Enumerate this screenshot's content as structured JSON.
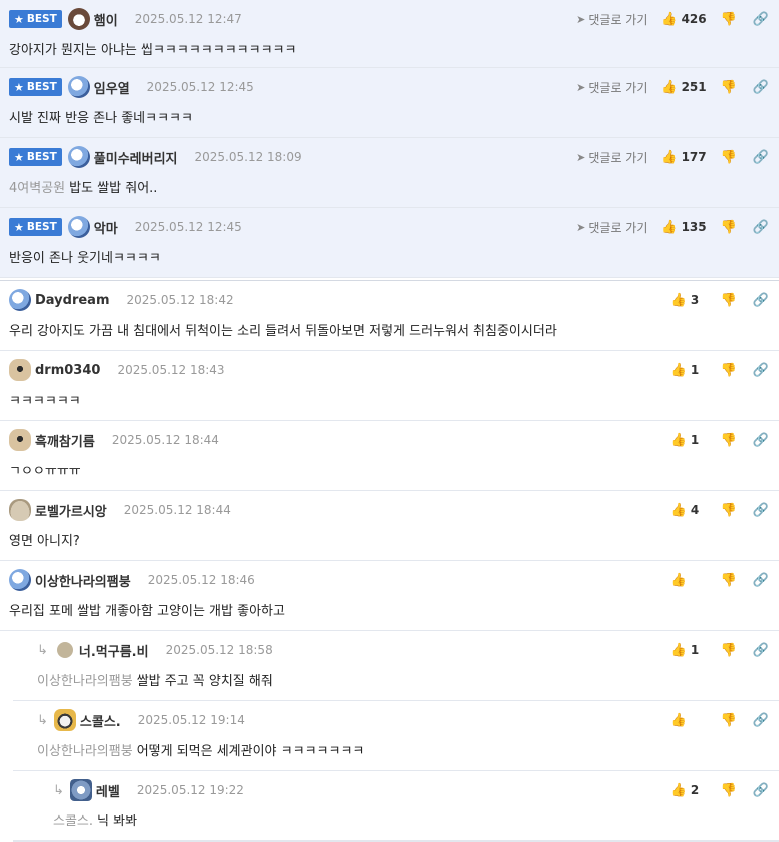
{
  "ui": {
    "best_label": "BEST",
    "goto_label": "댓글로 가기"
  },
  "best_comments": [
    {
      "avatar": "dog-face",
      "nick": "햄이",
      "date": "2025.05.12 12:47",
      "likes": "426",
      "mention": "",
      "text": "강아지가 뭔지는 아냐는 씹ㅋㅋㅋㅋㅋㅋㅋㅋㅋㅋㅋㅋ"
    },
    {
      "avatar": "ghost",
      "nick": "임우열",
      "date": "2025.05.12 12:45",
      "likes": "251",
      "mention": "",
      "text": "시발 진짜 반응 존나 좋네ㅋㅋㅋㅋ"
    },
    {
      "avatar": "ghost",
      "nick": "풀미수레버리지",
      "date": "2025.05.12 18:09",
      "likes": "177",
      "mention": "4여벽공원",
      "text": "밥도 쌀밥 줘어.."
    },
    {
      "avatar": "ghost",
      "nick": "악마",
      "date": "2025.05.12 12:45",
      "likes": "135",
      "mention": "",
      "text": "반응이 존나 웃기네ㅋㅋㅋㅋ"
    }
  ],
  "comments": [
    {
      "avatar": "ghost",
      "nick": "Daydream",
      "date": "2025.05.12 18:42",
      "likes": "3",
      "mention": "",
      "text": "우리 강아지도 가끔 내 침대에서 뒤척이는 소리 들려서 뒤돌아보면 저렇게 드러누워서 취침중이시더라"
    },
    {
      "avatar": "puppy",
      "nick": "drm0340",
      "date": "2025.05.12 18:43",
      "likes": "1",
      "mention": "",
      "text": "ㅋㅋㅋㅋㅋㅋ"
    },
    {
      "avatar": "puppy",
      "nick": "흑깨참기름",
      "date": "2025.05.12 18:44",
      "likes": "1",
      "mention": "",
      "text": "ㄱㅇㅇㅠㅠㅠ"
    },
    {
      "avatar": "seal",
      "nick": "로벨가르시앙",
      "date": "2025.05.12 18:44",
      "likes": "4",
      "mention": "",
      "text": "영면 아니지?"
    },
    {
      "avatar": "ghost",
      "nick": "이상한나라의팸붕",
      "date": "2025.05.12 18:46",
      "likes": "",
      "mention": "",
      "text": "우리집 포메 쌀밥 개좋아함 고양이는 개밥 좋아하고"
    }
  ],
  "replies": [
    {
      "avatar": "dot",
      "nick": "너.먹구름.비",
      "date": "2025.05.12 18:58",
      "likes": "1",
      "mention": "이상한나라의팸붕",
      "text": "쌀밥 주고 꼭 양치질 해줘"
    },
    {
      "avatar": "fox",
      "nick": "스콜스.",
      "date": "2025.05.12 19:14",
      "likes": "",
      "mention": "이상한나라의팸붕",
      "text": "어떻게 되먹은 세계관이야 ㅋㅋㅋㅋㅋㅋㅋ"
    }
  ],
  "nested_replies": [
    {
      "avatar": "wolf",
      "nick": "레벨",
      "date": "2025.05.12 19:22",
      "likes": "2",
      "mention": "스콜스.",
      "text": "닉 봐봐"
    }
  ]
}
